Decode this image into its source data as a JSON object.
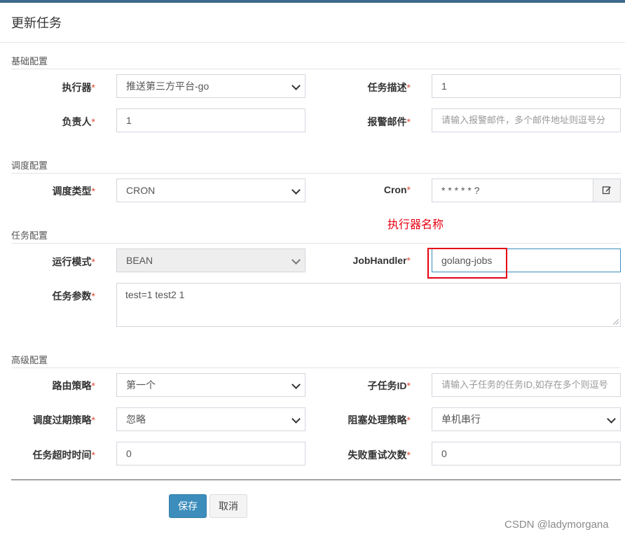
{
  "modal": {
    "title": "更新任务"
  },
  "sections": {
    "basic": "基础配置",
    "schedule": "调度配置",
    "task": "任务配置",
    "advanced": "高级配置"
  },
  "required_mark": "*",
  "fields": {
    "executor": {
      "label": "执行器",
      "value": "推送第三方平台-go"
    },
    "job_desc": {
      "label": "任务描述",
      "value": "1"
    },
    "author": {
      "label": "负责人",
      "value": "1"
    },
    "alarm_email": {
      "label": "报警邮件",
      "placeholder": "请输入报警邮件，多个邮件地址则逗号分"
    },
    "schedule_type": {
      "label": "调度类型",
      "value": "CRON"
    },
    "cron": {
      "label": "Cron",
      "value": "* * * * * ?"
    },
    "glue_type": {
      "label": "运行模式",
      "value": "BEAN"
    },
    "job_handler": {
      "label": "JobHandler",
      "value": "golang-jobs"
    },
    "job_param": {
      "label": "任务参数",
      "value": "test=1 test2 1"
    },
    "route_strategy": {
      "label": "路由策略",
      "value": "第一个"
    },
    "child_job_id": {
      "label": "子任务ID",
      "placeholder": "请输入子任务的任务ID,如存在多个则逗号"
    },
    "misfire_strategy": {
      "label": "调度过期策略",
      "value": "忽略"
    },
    "block_strategy": {
      "label": "阻塞处理策略",
      "value": "单机串行"
    },
    "timeout": {
      "label": "任务超时时间",
      "value": "0"
    },
    "fail_retry": {
      "label": "失败重试次数",
      "value": "0"
    }
  },
  "annotation": {
    "text": "执行器名称"
  },
  "buttons": {
    "save": "保存",
    "cancel": "取消"
  },
  "watermark": "CSDN @ladymorgana",
  "colors": {
    "primary": "#3c8dbc",
    "required": "#dd4b39",
    "annotation": "#e60012"
  },
  "icons": {
    "cron_edit": "edit-icon"
  }
}
